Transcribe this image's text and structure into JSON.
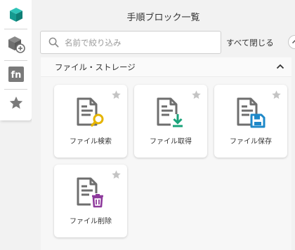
{
  "sidebar": {
    "items": [
      {
        "name": "blocks",
        "icon": "cube-icon",
        "color": "#1ba39c"
      },
      {
        "name": "add-block",
        "icon": "cube-add-icon",
        "color": "#7a7a7a"
      },
      {
        "name": "functions",
        "icon": "fn-icon",
        "color": "#7a7a7a",
        "text": "fn"
      },
      {
        "name": "favorites",
        "icon": "star-icon",
        "color": "#7a7a7a"
      }
    ]
  },
  "header": {
    "title": "手順ブロック一覧"
  },
  "search": {
    "placeholder": "名前で絞り込み",
    "value": ""
  },
  "toolbar": {
    "collapse_all_label": "すべて閉じる"
  },
  "category": {
    "label": "ファイル・ストレージ",
    "expanded": true
  },
  "blocks": [
    {
      "label": "ファイル検索",
      "badge": "search",
      "badge_color": "#e5b400"
    },
    {
      "label": "ファイル取得",
      "badge": "download",
      "badge_color": "#1aa37a"
    },
    {
      "label": "ファイル保存",
      "badge": "save",
      "badge_color": "#1e88c8"
    },
    {
      "label": "ファイル削除",
      "badge": "trash",
      "badge_color": "#8e3a9c"
    }
  ],
  "colors": {
    "doc_icon": "#6e6e6e",
    "star": "#c4c4c4",
    "accent": "#1ba39c"
  }
}
